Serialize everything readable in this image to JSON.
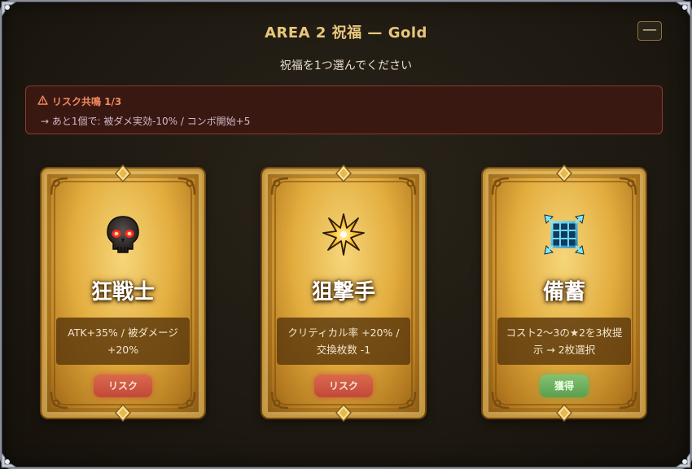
{
  "header": {
    "title": "AREA 2 祝福 — Gold",
    "minimize_label": "—"
  },
  "subtitle": "祝福を1つ選んでください",
  "risk_resonance": {
    "icon": "warning-icon",
    "title": "リスク共鳴 1/3",
    "detail": "→ あと1個で: 被ダメ実効-10% / コンボ開始+5"
  },
  "cards": [
    {
      "name": "狂戦士",
      "icon": "skull-icon",
      "description": "ATK+35% / 被ダメージ +20%",
      "badge": "リスク",
      "badge_type": "risk"
    },
    {
      "name": "狙撃手",
      "icon": "starburst-icon",
      "description": "クリティカル率 +20% / 交換枚数 -1",
      "badge": "リスク",
      "badge_type": "risk"
    },
    {
      "name": "備蓄",
      "icon": "expand-grid-icon",
      "description": "コスト2〜3の★2を3枚提示 → 2枚選択",
      "badge": "獲得",
      "badge_type": "gain"
    }
  ],
  "colors": {
    "title_gold": "#e9c77a",
    "risk_orange": "#f08a5f",
    "risk_badge": "#c95540",
    "gain_badge": "#6aac5a"
  }
}
